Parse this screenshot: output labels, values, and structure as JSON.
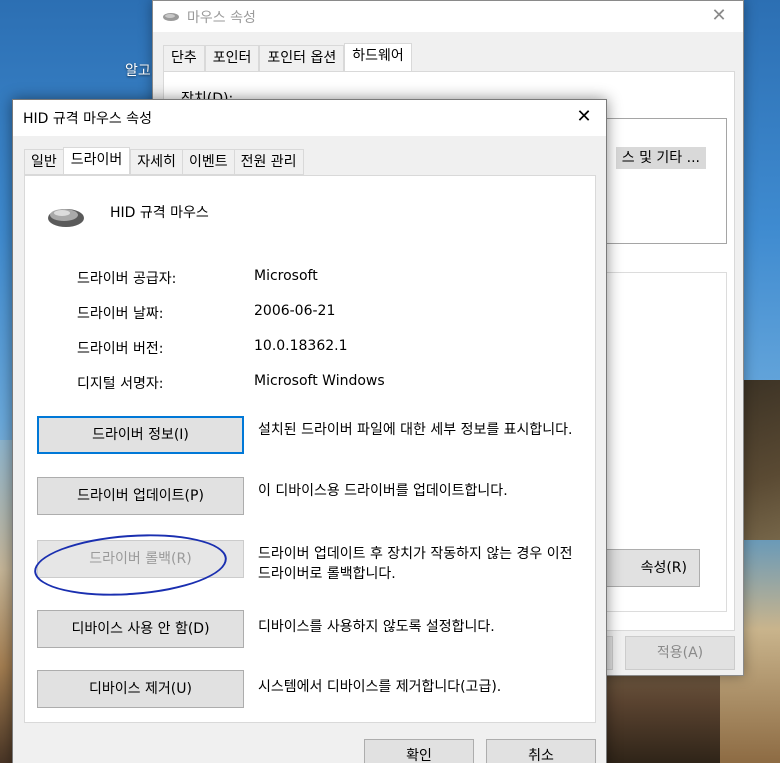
{
  "desktop": {
    "label": "알고"
  },
  "back_dialog": {
    "title": "마우스 속성",
    "tabs": [
      "단추",
      "포인터",
      "포인터 옵션",
      "하드웨어"
    ],
    "devices_label": "장치(D):",
    "list_item": "스 및 기타 ...",
    "properties_button": "속성(R)",
    "apply_button": "적용(A)"
  },
  "dialog": {
    "title": "HID 규격 마우스 속성",
    "tabs": [
      "일반",
      "드라이버",
      "자세히",
      "이벤트",
      "전원 관리"
    ],
    "device_name": "HID 규격 마우스",
    "fields": [
      {
        "label": "드라이버 공급자:",
        "value": "Microsoft"
      },
      {
        "label": "드라이버 날짜:",
        "value": "2006-06-21"
      },
      {
        "label": "드라이버 버전:",
        "value": "10.0.18362.1"
      },
      {
        "label": "디지털 서명자:",
        "value": "Microsoft Windows"
      }
    ],
    "buttons": [
      {
        "label": "드라이버 정보(I)",
        "desc": "설치된 드라이버 파일에 대한 세부 정보를 표시합니다."
      },
      {
        "label": "드라이버 업데이트(P)",
        "desc": "이 디바이스용 드라이버를 업데이트합니다."
      },
      {
        "label": "드라이버 롤백(R)",
        "desc": "드라이버 업데이트 후 장치가 작동하지 않는 경우 이전 드라이버로 롤백합니다."
      },
      {
        "label": "디바이스 사용 안 함(D)",
        "desc": "디바이스를 사용하지 않도록 설정합니다."
      },
      {
        "label": "디바이스 제거(U)",
        "desc": "시스템에서 디바이스를 제거합니다(고급)."
      }
    ],
    "ok_button": "확인",
    "cancel_button": "취소"
  },
  "colors": {
    "focus_border": "#0078d7",
    "annotation_circle": "#1a2fb0",
    "disabled_text": "#9a9a9a"
  }
}
